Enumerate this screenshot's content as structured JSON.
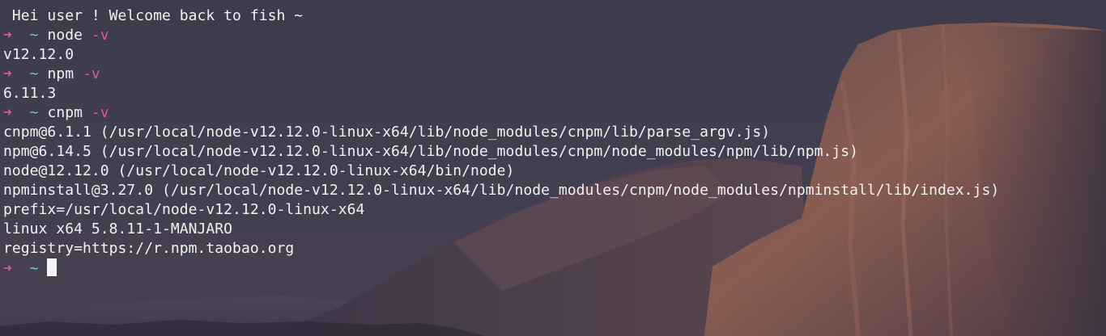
{
  "terminal": {
    "welcome": " Hei user ! Welcome back to fish ~",
    "prompt_arrow": "➜",
    "prompt_dir": "~",
    "commands": [
      {
        "cmd": "node",
        "flag": "-v"
      },
      {
        "cmd": "npm",
        "flag": "-v"
      },
      {
        "cmd": "cnpm",
        "flag": "-v"
      }
    ],
    "outputs": [
      "v12.12.0",
      "6.11.3",
      "cnpm@6.1.1 (/usr/local/node-v12.12.0-linux-x64/lib/node_modules/cnpm/lib/parse_argv.js)",
      "npm@6.14.5 (/usr/local/node-v12.12.0-linux-x64/lib/node_modules/cnpm/node_modules/npm/lib/npm.js)",
      "node@12.12.0 (/usr/local/node-v12.12.0-linux-x64/bin/node)",
      "npminstall@3.27.0 (/usr/local/node-v12.12.0-linux-x64/lib/node_modules/cnpm/node_modules/npminstall/lib/index.js)",
      "prefix=/usr/local/node-v12.12.0-linux-x64",
      "linux x64 5.8.11-1-MANJARO",
      "registry=https://r.npm.taobao.org"
    ]
  },
  "colors": {
    "background": "#3b3a4a",
    "text": "#f2f2f2",
    "prompt_arrow": "#d6589e",
    "prompt_dir": "#5fd5d0",
    "flag": "#d6589e",
    "cursor": "#f5f5f5"
  }
}
